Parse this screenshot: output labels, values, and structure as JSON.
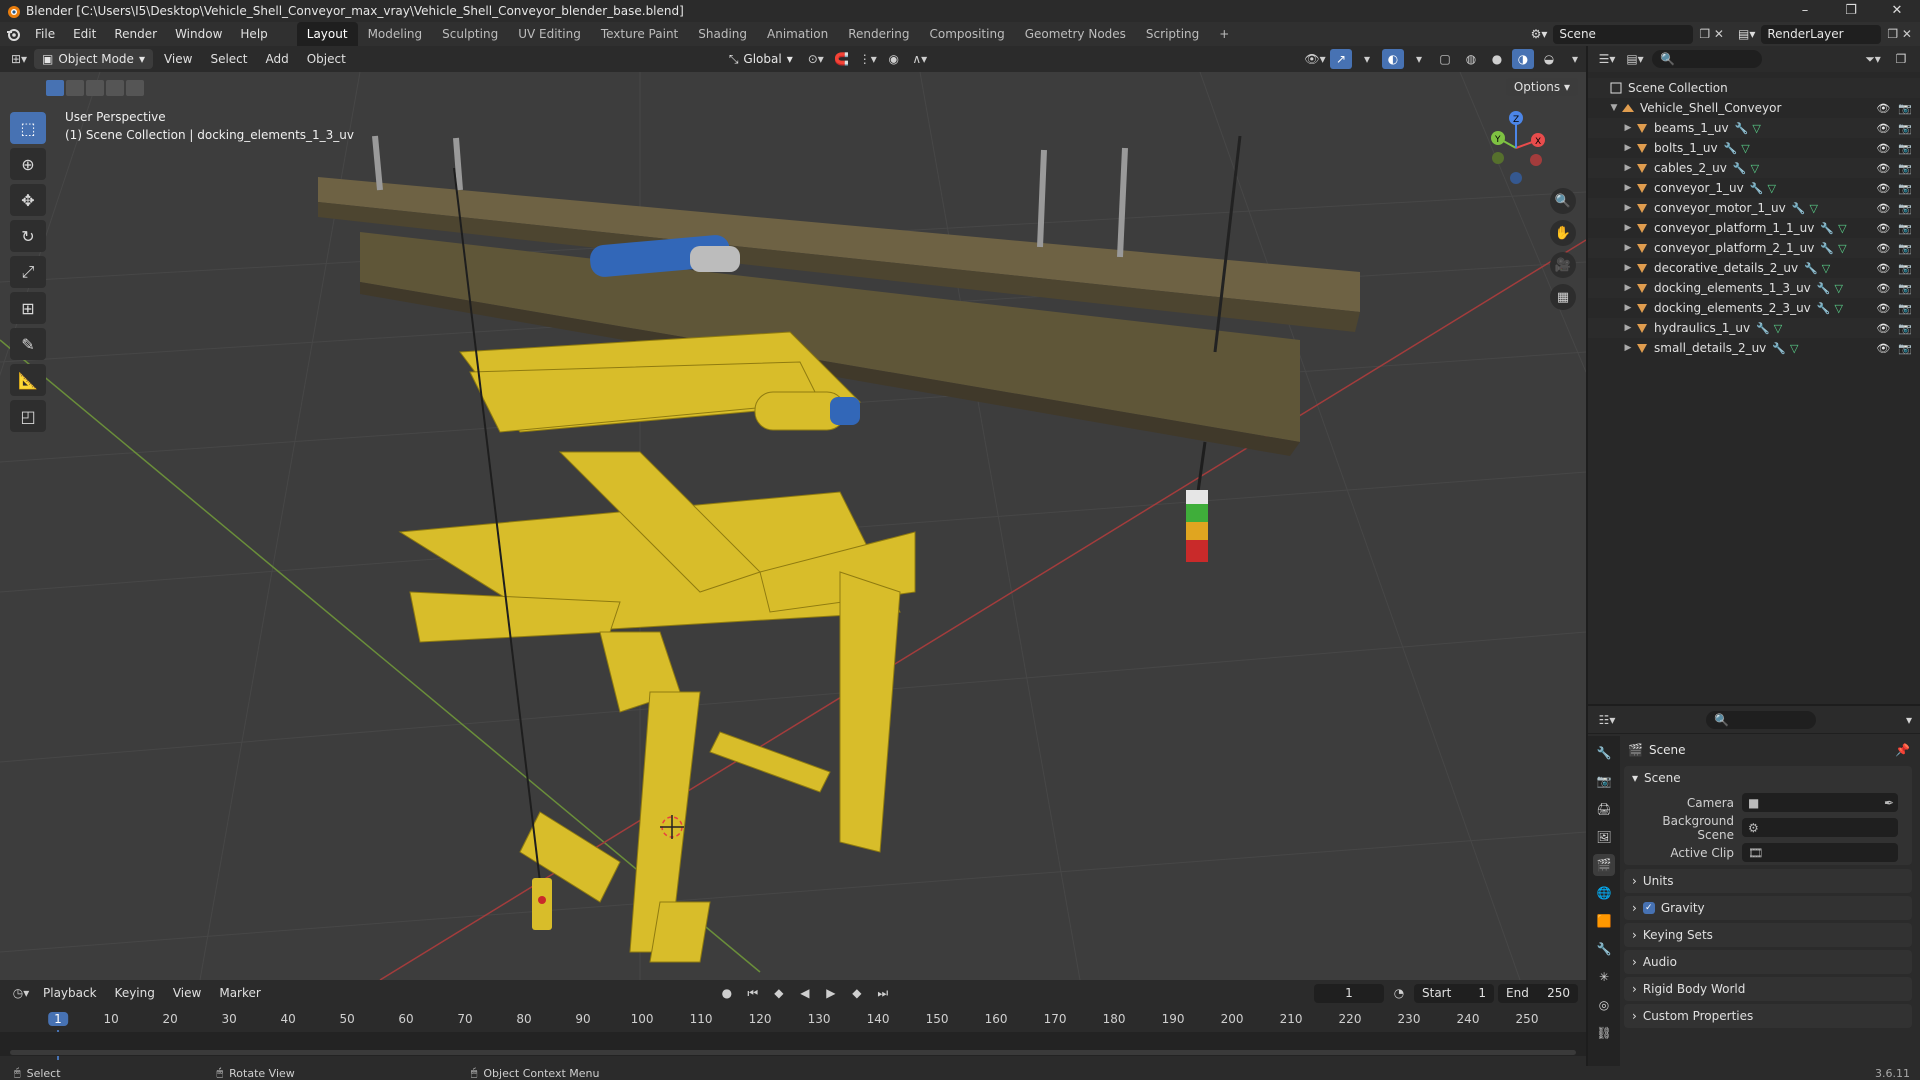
{
  "window": {
    "title": "Blender [C:\\Users\\I5\\Desktop\\Vehicle_Shell_Conveyor_max_vray\\Vehicle_Shell_Conveyor_blender_base.blend]",
    "controls": [
      "–",
      "❐",
      "✕"
    ]
  },
  "menubar": {
    "menus": [
      "File",
      "Edit",
      "Render",
      "Window",
      "Help"
    ],
    "workspaces": [
      "Layout",
      "Modeling",
      "Sculpting",
      "UV Editing",
      "Texture Paint",
      "Shading",
      "Animation",
      "Rendering",
      "Compositing",
      "Geometry Nodes",
      "Scripting"
    ],
    "active_workspace": "Layout",
    "add_tab": "+",
    "scene": "Scene",
    "view_layer": "RenderLayer"
  },
  "viewport_header": {
    "mode": "Object Mode",
    "menus": [
      "View",
      "Select",
      "Add",
      "Object"
    ],
    "orientation": "Global",
    "options": "Options"
  },
  "viewport": {
    "perspective": "User Perspective",
    "collection_info": "(1) Scene Collection | docking_elements_1_3_uv",
    "gizmo_axes": [
      "X",
      "Y",
      "Z"
    ]
  },
  "timeline": {
    "menus": [
      "Playback",
      "Keying",
      "View",
      "Marker"
    ],
    "current_frame": "1",
    "start_label": "Start",
    "start": "1",
    "end_label": "End",
    "end": "250",
    "ticks": [
      "1",
      "10",
      "20",
      "30",
      "40",
      "50",
      "60",
      "70",
      "80",
      "90",
      "100",
      "110",
      "120",
      "130",
      "140",
      "150",
      "160",
      "170",
      "180",
      "190",
      "200",
      "210",
      "220",
      "230",
      "240",
      "250"
    ]
  },
  "statusbar": {
    "select": "Select",
    "rotate": "Rotate View",
    "context": "Object Context Menu",
    "version": "3.6.11"
  },
  "outliner": {
    "root": "Scene Collection",
    "collection": "Vehicle_Shell_Conveyor",
    "objects": [
      {
        "name": "beams_1_uv"
      },
      {
        "name": "bolts_1_uv"
      },
      {
        "name": "cables_2_uv"
      },
      {
        "name": "conveyor_1_uv"
      },
      {
        "name": "conveyor_motor_1_uv"
      },
      {
        "name": "conveyor_platform_1_1_uv"
      },
      {
        "name": "conveyor_platform_2_1_uv"
      },
      {
        "name": "decorative_details_2_uv"
      },
      {
        "name": "docking_elements_1_3_uv"
      },
      {
        "name": "docking_elements_2_3_uv"
      },
      {
        "name": "hydraulics_1_uv"
      },
      {
        "name": "small_details_2_uv"
      }
    ]
  },
  "properties": {
    "context": "Scene",
    "panel_title": "Scene",
    "camera_label": "Camera",
    "background_label": "Background Scene",
    "clip_label": "Active Clip",
    "sections": [
      "Units",
      "Gravity",
      "Keying Sets",
      "Audio",
      "Rigid Body World",
      "Custom Properties"
    ]
  }
}
